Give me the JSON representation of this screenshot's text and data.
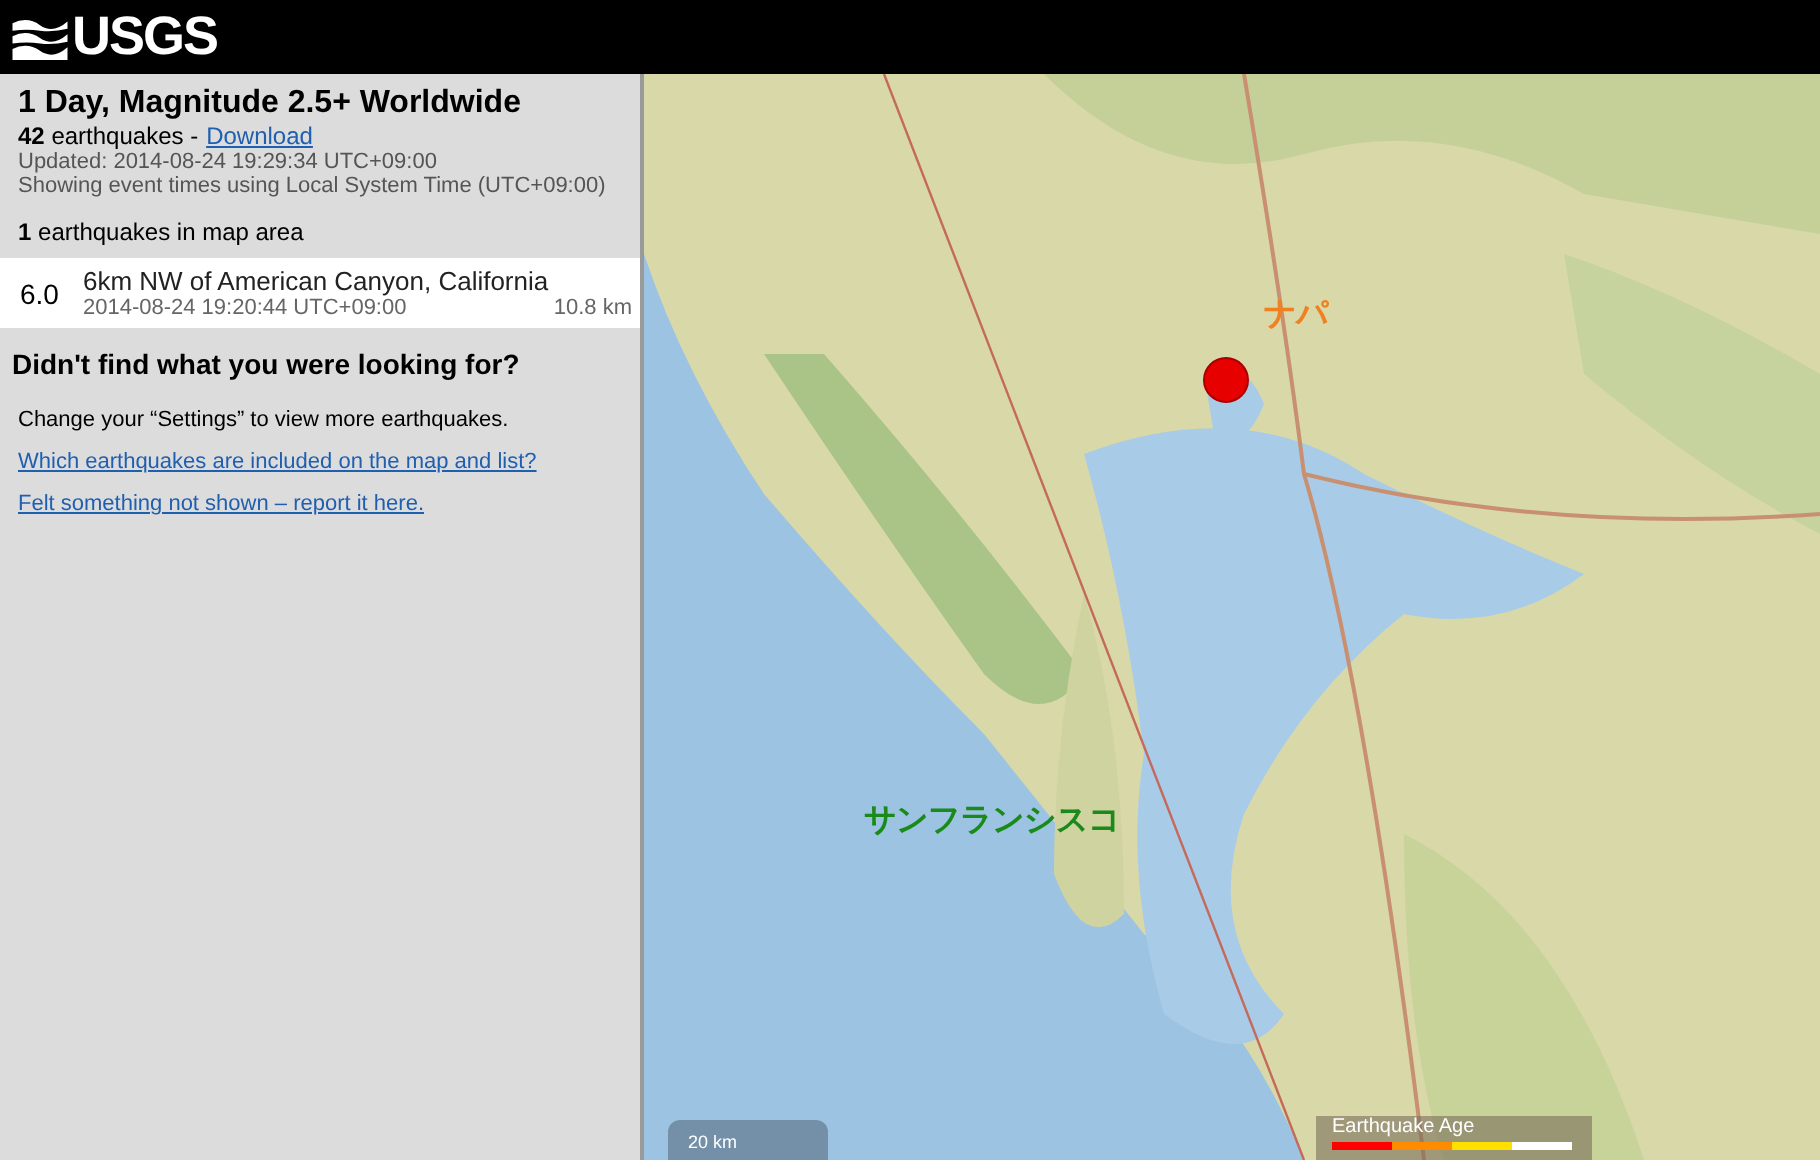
{
  "header": {
    "logo": "USGS"
  },
  "summary": {
    "title": "1 Day, Magnitude 2.5+ Worldwide",
    "count": "42",
    "count_label": "earthquakes -",
    "download": "Download",
    "updated": "Updated: 2014-08-24 19:29:34 UTC+09:00",
    "timezone": "Showing event times using Local System Time (UTC+09:00)",
    "map_count": "1",
    "map_count_label": "earthquakes in map area"
  },
  "events": [
    {
      "magnitude": "6.0",
      "place": "6km NW of American Canyon, California",
      "time": "2014-08-24 19:20:44 UTC+09:00",
      "depth": "10.8 km"
    }
  ],
  "help": {
    "heading": "Didn't find what you were looking for?",
    "text": "Change your “Settings” to view more earthquakes.",
    "links": [
      "Which earthquakes are included on the map and list?",
      "Felt something not shown – report it here."
    ]
  },
  "map": {
    "kind": "picture",
    "labels": [
      {
        "text": "ナパ",
        "color": "#f08020"
      },
      {
        "text": "サンフランシスコ",
        "color": "#1a8a1a"
      }
    ],
    "scale": "20 km",
    "legend": {
      "title": "Earthquake Age",
      "segments": [
        {
          "color": "#ff0000"
        },
        {
          "color": "#ff8c00"
        },
        {
          "color": "#ffe000"
        },
        {
          "color": "#ffffff"
        }
      ]
    }
  }
}
